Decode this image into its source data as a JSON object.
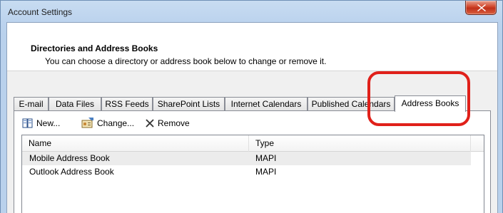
{
  "window": {
    "title": "Account Settings"
  },
  "header": {
    "title": "Directories and Address Books",
    "description": "You can choose a directory or address book below to change or remove it."
  },
  "tabs": [
    {
      "label": "E-mail"
    },
    {
      "label": "Data Files"
    },
    {
      "label": "RSS Feeds"
    },
    {
      "label": "SharePoint Lists"
    },
    {
      "label": "Internet Calendars"
    },
    {
      "label": "Published Calendars"
    },
    {
      "label": "Address Books",
      "active": true
    }
  ],
  "toolbar": {
    "new_label": "New...",
    "change_label": "Change...",
    "remove_label": "Remove"
  },
  "list": {
    "columns": [
      "Name",
      "Type"
    ],
    "rows": [
      {
        "name": "Mobile Address Book",
        "type": "MAPI",
        "selected": true
      },
      {
        "name": "Outlook Address Book",
        "type": "MAPI",
        "selected": false
      }
    ]
  },
  "colors": {
    "annotation": "#e0201a",
    "close_button": "#c0311b"
  }
}
